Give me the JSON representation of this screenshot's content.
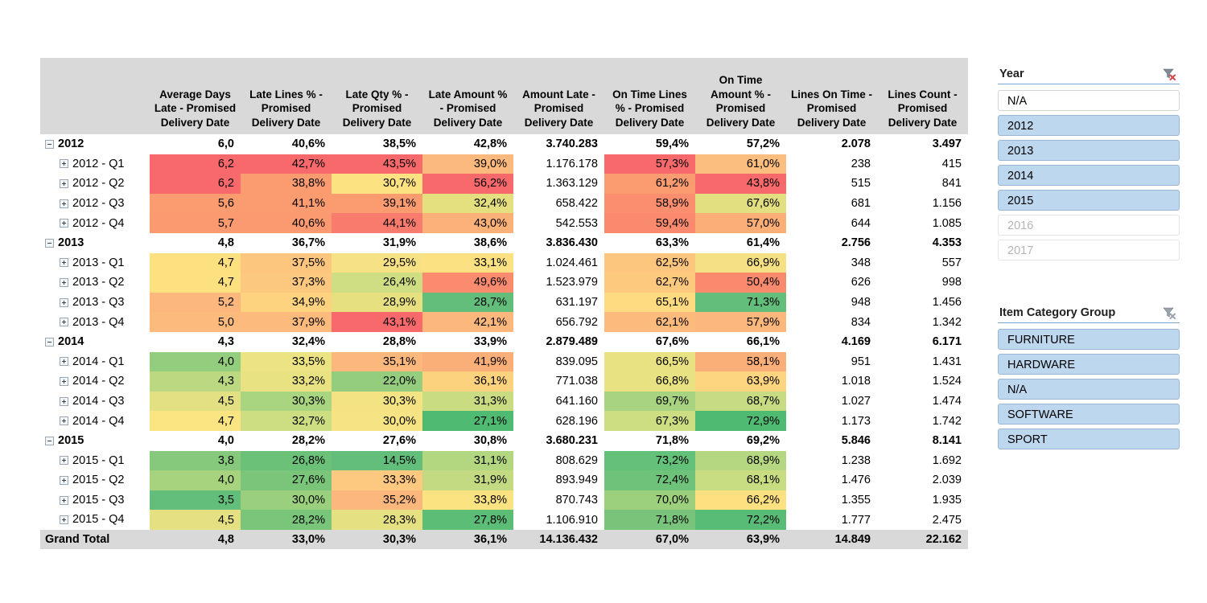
{
  "table": {
    "row_header_label": "",
    "columns": [
      "Average Days Late - Promised Delivery Date",
      "Late Lines % - Promised Delivery Date",
      "Late Qty % - Promised Delivery Date",
      "Late Amount % - Promised Delivery Date",
      "Amount Late - Promised Delivery Date",
      "On Time Lines % - Promised Delivery Date",
      "On Time Amount % - Promised Delivery Date",
      "Lines On Time - Promised Delivery Date",
      "Lines Count - Promised Delivery Date"
    ],
    "rows": [
      {
        "label": "2012",
        "type": "year",
        "toggle": "minus",
        "values": [
          "6,0",
          "40,6%",
          "38,5%",
          "42,8%",
          "3.740.283",
          "59,4%",
          "57,2%",
          "2.078",
          "3.497"
        ],
        "colors": [
          "",
          "",
          "",
          "",
          "",
          "",
          "",
          "",
          ""
        ]
      },
      {
        "label": "2012 - Q1",
        "type": "quarter",
        "toggle": "plus",
        "values": [
          "6,2",
          "42,7%",
          "43,5%",
          "39,0%",
          "1.176.178",
          "57,3%",
          "61,0%",
          "238",
          "415"
        ],
        "colors": [
          "#f8696b",
          "#f8696b",
          "#f8696b",
          "#fcb97d",
          "",
          "#f8696b",
          "#fcbe7e",
          "",
          ""
        ]
      },
      {
        "label": "2012 - Q2",
        "type": "quarter",
        "toggle": "plus",
        "values": [
          "6,2",
          "38,8%",
          "30,7%",
          "56,2%",
          "1.363.129",
          "61,2%",
          "43,8%",
          "515",
          "841"
        ],
        "colors": [
          "#f8696b",
          "#fa9b70",
          "#fce281",
          "",
          "#f8696b",
          "#fa9b70",
          "#f8696b",
          "",
          ""
        ],
        "colors_fix": [
          "#f8696b",
          "#fa9b70",
          "#fce281",
          "#f8696b",
          "",
          "#fa9b70",
          "#f8696b",
          "",
          ""
        ]
      },
      {
        "label": "2012 - Q3",
        "type": "quarter",
        "toggle": "plus",
        "values": [
          "5,6",
          "41,1%",
          "39,1%",
          "32,4%",
          "658.422",
          "58,9%",
          "67,6%",
          "681",
          "1.156"
        ],
        "colors_fix": [
          "#fb9c70",
          "#fb9c70",
          "#fb9c70",
          "#e5e07f",
          "",
          "#fa8e6e",
          "#e2df80",
          "",
          ""
        ]
      },
      {
        "label": "2012 - Q4",
        "type": "quarter",
        "toggle": "plus",
        "values": [
          "5,7",
          "40,6%",
          "44,1%",
          "43,0%",
          "542.553",
          "59,4%",
          "57,0%",
          "644",
          "1.085"
        ],
        "colors_fix": [
          "#fb9a70",
          "#fb9a70",
          "#f97b6d",
          "#fcb178",
          "",
          "#fa8a6d",
          "#fcae77",
          "",
          ""
        ]
      },
      {
        "label": "2013",
        "type": "year",
        "toggle": "minus",
        "values": [
          "4,8",
          "36,7%",
          "31,9%",
          "38,6%",
          "3.836.430",
          "63,3%",
          "61,4%",
          "2.756",
          "4.353"
        ],
        "colors_fix": [
          "",
          "",
          "",
          "",
          "",
          "",
          "",
          "",
          ""
        ]
      },
      {
        "label": "2013 - Q1",
        "type": "quarter",
        "toggle": "plus",
        "values": [
          "4,7",
          "37,5%",
          "29,5%",
          "33,1%",
          "1.024.461",
          "62,5%",
          "66,9%",
          "348",
          "557"
        ],
        "colors_fix": [
          "#fde07f",
          "#fcc67f",
          "#f6e184",
          "#fbe182",
          "",
          "#fdc67f",
          "#f5e083",
          "",
          ""
        ]
      },
      {
        "label": "2013 - Q2",
        "type": "quarter",
        "toggle": "plus",
        "values": [
          "4,7",
          "37,3%",
          "26,4%",
          "49,6%",
          "1.523.979",
          "62,7%",
          "50,4%",
          "626",
          "998"
        ],
        "colors_fix": [
          "#fde07f",
          "#fcc77f",
          "#cfdd83",
          "#fb8b6e",
          "",
          "#fdc97f",
          "#fa8a6e",
          "",
          ""
        ]
      },
      {
        "label": "2013 - Q3",
        "type": "quarter",
        "toggle": "plus",
        "values": [
          "5,2",
          "34,9%",
          "28,9%",
          "28,7%",
          "631.197",
          "65,1%",
          "71,3%",
          "948",
          "1.456"
        ],
        "colors_fix": [
          "#fcb87c",
          "#fdd37f",
          "#e7e081",
          "#63be7b",
          "",
          "#fedb80",
          "#63be7b",
          "",
          ""
        ]
      },
      {
        "label": "2013 - Q4",
        "type": "quarter",
        "toggle": "plus",
        "values": [
          "5,0",
          "37,9%",
          "43,1%",
          "42,1%",
          "656.792",
          "62,1%",
          "57,9%",
          "834",
          "1.342"
        ],
        "colors_fix": [
          "#fcbb7d",
          "#fcbb7d",
          "#f8696b",
          "#fcb77c",
          "",
          "#fcbb7d",
          "#fcb77c",
          "",
          ""
        ]
      },
      {
        "label": "2014",
        "type": "year",
        "toggle": "minus",
        "values": [
          "4,3",
          "32,4%",
          "28,8%",
          "33,9%",
          "2.879.489",
          "67,6%",
          "66,1%",
          "4.169",
          "6.171"
        ],
        "colors_fix": [
          "",
          "",
          "",
          "",
          "",
          "",
          "",
          "",
          ""
        ]
      },
      {
        "label": "2014 - Q1",
        "type": "quarter",
        "toggle": "plus",
        "values": [
          "4,0",
          "33,5%",
          "35,1%",
          "41,9%",
          "839.095",
          "66,5%",
          "58,1%",
          "951",
          "1.431"
        ],
        "colors_fix": [
          "#93cd7e",
          "#ece382",
          "#fbb77c",
          "#fbaf78",
          "",
          "#e9e282",
          "#fbaf78",
          "",
          ""
        ]
      },
      {
        "label": "2014 - Q2",
        "type": "quarter",
        "toggle": "plus",
        "values": [
          "4,3",
          "33,2%",
          "22,0%",
          "36,1%",
          "771.038",
          "66,8%",
          "63,9%",
          "1.018",
          "1.524"
        ],
        "colors_fix": [
          "#bcd982",
          "#e9e282",
          "#94cd7e",
          "#fdd27f",
          "",
          "#e9e282",
          "#fdd47f",
          "",
          ""
        ]
      },
      {
        "label": "2014 - Q3",
        "type": "quarter",
        "toggle": "plus",
        "values": [
          "4,5",
          "30,3%",
          "30,3%",
          "31,3%",
          "641.160",
          "69,7%",
          "68,7%",
          "1.027",
          "1.474"
        ],
        "colors_fix": [
          "#e2e083",
          "#a9d480",
          "#f3e383",
          "#c9dc82",
          "",
          "#a8d380",
          "#c6db82",
          "",
          ""
        ]
      },
      {
        "label": "2014 - Q4",
        "type": "quarter",
        "toggle": "plus",
        "values": [
          "4,7",
          "32,7%",
          "30,0%",
          "27,1%",
          "628.196",
          "67,3%",
          "72,9%",
          "1.173",
          "1.742"
        ],
        "colors_fix": [
          "#fbe482",
          "#ccdd82",
          "#f6e484",
          "#4fba72",
          "",
          "#cddd82",
          "#4fba72",
          "",
          ""
        ]
      },
      {
        "label": "2015",
        "type": "year",
        "toggle": "minus",
        "values": [
          "4,0",
          "28,2%",
          "27,6%",
          "30,8%",
          "3.680.231",
          "71,8%",
          "69,2%",
          "5.846",
          "8.141"
        ],
        "colors_fix": [
          "",
          "",
          "",
          "",
          "",
          "",
          "",
          "",
          ""
        ]
      },
      {
        "label": "2015 - Q1",
        "type": "quarter",
        "toggle": "plus",
        "values": [
          "3,8",
          "26,8%",
          "14,5%",
          "31,1%",
          "808.629",
          "73,2%",
          "68,9%",
          "1.238",
          "1.692"
        ],
        "colors_fix": [
          "#86c97c",
          "#6cc178",
          "#63be7b",
          "#b3d681",
          "",
          "#63c179",
          "#b6d781",
          "",
          ""
        ]
      },
      {
        "label": "2015 - Q2",
        "type": "quarter",
        "toggle": "plus",
        "values": [
          "4,0",
          "27,6%",
          "33,3%",
          "31,9%",
          "893.949",
          "72,4%",
          "68,1%",
          "1.476",
          "2.039"
        ],
        "colors_fix": [
          "#a7d37f",
          "#7ac57a",
          "#fdc87f",
          "#c3da82",
          "",
          "#6fc279",
          "#c8dc82",
          "",
          ""
        ]
      },
      {
        "label": "2015 - Q3",
        "type": "quarter",
        "toggle": "plus",
        "values": [
          "3,5",
          "30,0%",
          "35,2%",
          "33,8%",
          "870.743",
          "70,0%",
          "66,2%",
          "1.355",
          "1.935"
        ],
        "colors_fix": [
          "#63be7b",
          "#9ad07d",
          "#fbb77c",
          "#fce382",
          "",
          "#9dd07d",
          "#fde181",
          "",
          ""
        ]
      },
      {
        "label": "2015 - Q4",
        "type": "quarter",
        "toggle": "plus",
        "values": [
          "4,5",
          "28,2%",
          "28,3%",
          "27,8%",
          "1.106.910",
          "71,8%",
          "72,2%",
          "1.777",
          "2.475"
        ],
        "colors_fix": [
          "#e5e182",
          "#79c57a",
          "#e5e182",
          "#5bbd76",
          "",
          "#77c47a",
          "#59bc76",
          "",
          ""
        ]
      },
      {
        "label": "Grand Total",
        "type": "total",
        "toggle": "none",
        "values": [
          "4,8",
          "33,0%",
          "30,3%",
          "36,1%",
          "14.136.432",
          "67,0%",
          "63,9%",
          "14.849",
          "22.162"
        ],
        "colors_fix": [
          "",
          "",
          "",
          "",
          "",
          "",
          "",
          "",
          ""
        ]
      }
    ]
  },
  "slicers": [
    {
      "title": "Year",
      "clear_icon": "clear-filter-icon",
      "items": [
        {
          "label": "N/A",
          "state": "unselected"
        },
        {
          "label": "2012",
          "state": "selected"
        },
        {
          "label": "2013",
          "state": "selected"
        },
        {
          "label": "2014",
          "state": "selected"
        },
        {
          "label": "2015",
          "state": "selected"
        },
        {
          "label": "2016",
          "state": "empty"
        },
        {
          "label": "2017",
          "state": "empty"
        }
      ]
    },
    {
      "title": "Item Category Group",
      "clear_icon": "clear-filter-icon",
      "items": [
        {
          "label": "FURNITURE",
          "state": "selected"
        },
        {
          "label": "HARDWARE",
          "state": "selected"
        },
        {
          "label": "N/A",
          "state": "selected"
        },
        {
          "label": "SOFTWARE",
          "state": "selected"
        },
        {
          "label": "SPORT",
          "state": "selected"
        }
      ]
    }
  ],
  "theme": {
    "header_bg": "#d9d9d9",
    "total_bg": "#d9d9d9",
    "slicer_selected_bg": "#bdd7ee",
    "slicer_accent": "#7ba7d7",
    "heat_red": "#f8696b",
    "heat_yellow": "#fce382",
    "heat_green": "#63be7b"
  }
}
